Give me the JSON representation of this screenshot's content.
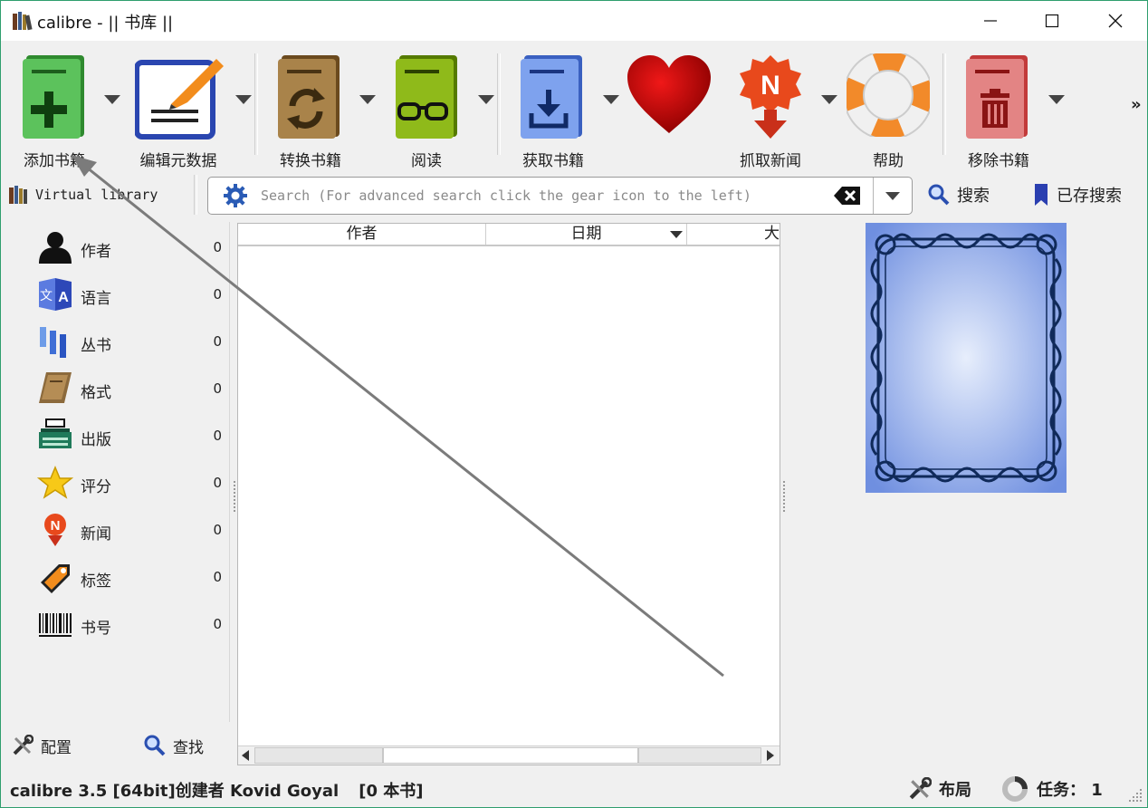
{
  "window": {
    "title": "calibre - || 书库 ||"
  },
  "toolbar": {
    "items": [
      {
        "label": "添加书籍"
      },
      {
        "label": "编辑元数据"
      },
      {
        "label": "转换书籍"
      },
      {
        "label": "阅读"
      },
      {
        "label": "获取书籍"
      },
      {
        "label": ""
      },
      {
        "label": "抓取新闻"
      },
      {
        "label": "帮助"
      },
      {
        "label": "移除书籍"
      }
    ],
    "overflow": "»"
  },
  "search": {
    "virtual_library": "Virtual library",
    "placeholder": "Search (For advanced search click the gear icon to the left)",
    "search_label": "搜索",
    "saved_label": "已存搜索"
  },
  "categories": [
    {
      "name": "作者",
      "count": "0",
      "icon": "person-icon"
    },
    {
      "name": "语言",
      "count": "0",
      "icon": "language-icon"
    },
    {
      "name": "丛书",
      "count": "0",
      "icon": "series-icon"
    },
    {
      "name": "格式",
      "count": "0",
      "icon": "format-book-icon"
    },
    {
      "name": "出版",
      "count": "0",
      "icon": "publisher-icon"
    },
    {
      "name": "评分",
      "count": "0",
      "icon": "star-icon"
    },
    {
      "name": "新闻",
      "count": "0",
      "icon": "news-icon"
    },
    {
      "name": "标签",
      "count": "0",
      "icon": "tag-icon"
    },
    {
      "name": "书号",
      "count": "0",
      "icon": "barcode-icon"
    }
  ],
  "leftbottom": {
    "configure": "配置",
    "find": "查找"
  },
  "columns": {
    "author": "作者",
    "date": "日期",
    "size": "大"
  },
  "status": {
    "text": "calibre 3.5 [64bit]创建者 Kovid Goyal",
    "count": "[0 本书]",
    "layout": "布局",
    "jobs": "任务： 1"
  }
}
